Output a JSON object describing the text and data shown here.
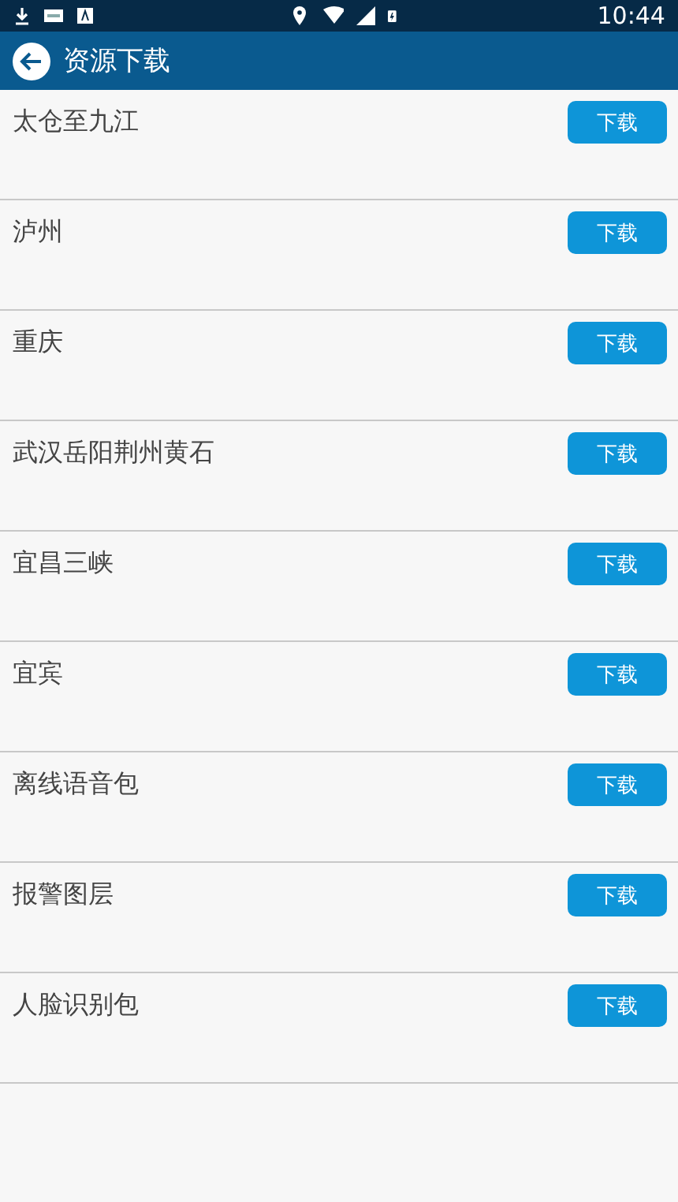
{
  "status_bar": {
    "time": "10:44"
  },
  "header": {
    "title": "资源下载"
  },
  "items": [
    {
      "name": "太仓至九江",
      "button": "下载"
    },
    {
      "name": "泸州",
      "button": "下载"
    },
    {
      "name": "重庆",
      "button": "下载"
    },
    {
      "name": "武汉岳阳荆州黄石",
      "button": "下载"
    },
    {
      "name": "宜昌三峡",
      "button": "下载"
    },
    {
      "name": "宜宾",
      "button": "下载"
    },
    {
      "name": "离线语音包",
      "button": "下载"
    },
    {
      "name": "报警图层",
      "button": "下载"
    },
    {
      "name": "人脸识别包",
      "button": "下载"
    }
  ]
}
